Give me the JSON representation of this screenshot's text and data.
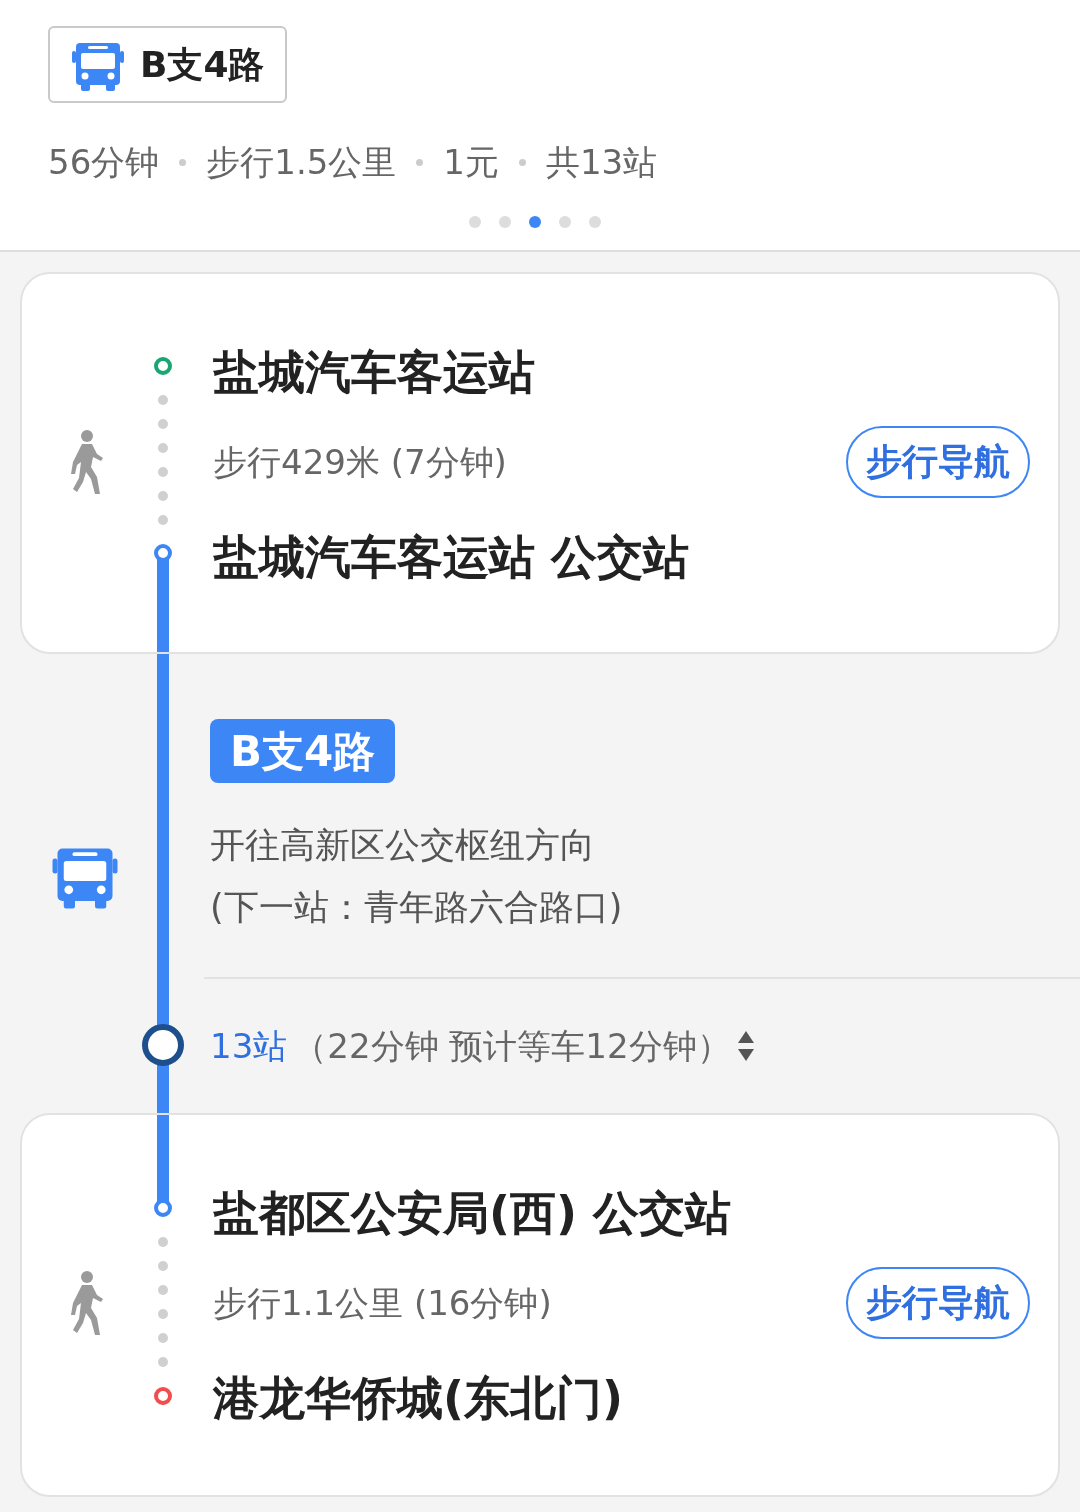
{
  "route_button": {
    "label": "B支4路"
  },
  "summary": [
    "56分钟",
    "步行1.5公里",
    "1元",
    "共13站"
  ],
  "pager": [
    {
      "selected": false
    },
    {
      "selected": false
    },
    {
      "selected": true
    },
    {
      "selected": false
    },
    {
      "selected": false
    }
  ],
  "origin_card": {
    "start": "盐城汽车客运站",
    "walk": "步行429米 (7分钟)",
    "nav_button": "步行导航",
    "stop": "盐城汽车客运站 公交站"
  },
  "bus_leg": {
    "line": "B支4路",
    "direction": "开往高新区公交枢纽方向",
    "next_stop": "(下一站：青年路六合路口)",
    "stops": "13站",
    "duration": "（22分钟 预计等车12分钟）"
  },
  "destination_card": {
    "stop": "盐都区公安局(西) 公交站",
    "walk": "步行1.1公里 (16分钟)",
    "nav_button": "步行导航",
    "end": "港龙华侨城(东北门)"
  }
}
